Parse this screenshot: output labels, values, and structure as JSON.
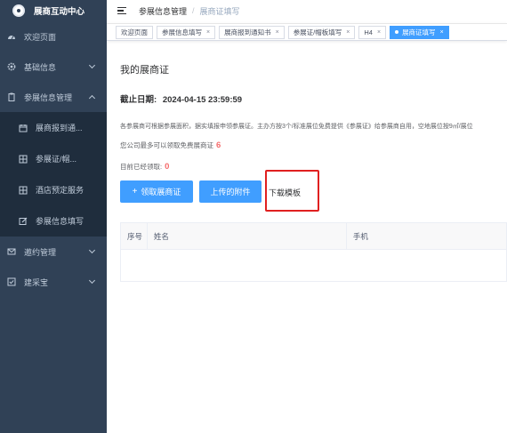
{
  "app": {
    "title": "展商互动中心"
  },
  "sidebar": {
    "items": [
      {
        "label": "欢迎页面",
        "icon": "dashboard-icon"
      },
      {
        "label": "基础信息",
        "icon": "gear-icon"
      },
      {
        "label": "参展信息管理",
        "icon": "clipboard-icon"
      },
      {
        "label": "邀约管理",
        "icon": "mail-icon"
      },
      {
        "label": "建采宝",
        "icon": "checklist-icon"
      }
    ],
    "submenu": [
      {
        "label": "展商报到通...",
        "icon": "calendar-icon"
      },
      {
        "label": "参展证/帽...",
        "icon": "grid-icon"
      },
      {
        "label": "酒店预定服务",
        "icon": "grid-icon"
      },
      {
        "label": "参展信息填写",
        "icon": "edit-icon"
      }
    ]
  },
  "header": {
    "breadcrumb": [
      "参展信息管理",
      "展商证填写"
    ]
  },
  "tags": [
    {
      "label": "欢迎页面",
      "closable": false
    },
    {
      "label": "参展信息填写",
      "closable": true
    },
    {
      "label": "展商报到通知书",
      "closable": true
    },
    {
      "label": "参展证/帽板填写",
      "closable": true
    },
    {
      "label": "H4",
      "closable": true
    },
    {
      "label": "展商证填写",
      "closable": true,
      "active": true
    }
  ],
  "main": {
    "title": "我的展商证",
    "deadline_label": "截止日期:",
    "deadline_value": "2024-04-15 23:59:59",
    "notice": "各参展商可根据参展面积，据实填报申领参展证。主办方按3个/标准展位免费提供《参展证》给参展商自用，空地展位按9㎡/展位",
    "quota_text": "您公司最多可以领取免费展商证",
    "quota_value": "6",
    "claimed_text": "目前已经领取:",
    "claimed_value": "0",
    "btn_claim": "领取展商证",
    "btn_upload": "上传的附件",
    "btn_download": "下载模板",
    "table_headers": [
      "序号",
      "姓名",
      "手机"
    ]
  },
  "colors": {
    "sidebar_bg": "#304156",
    "primary": "#409eff",
    "danger": "#f56c6c",
    "highlight_box": "#e02020"
  }
}
